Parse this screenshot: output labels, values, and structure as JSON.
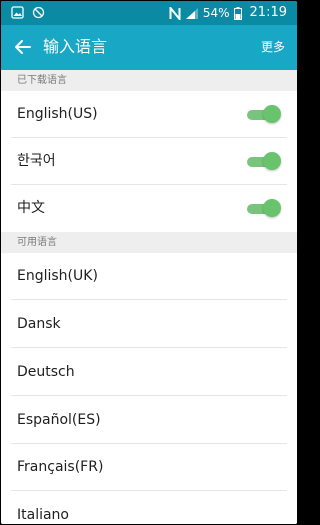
{
  "status_bar": {
    "battery": "54%",
    "time": "21:19"
  },
  "app_bar": {
    "title": "输入语言",
    "more": "更多"
  },
  "downloaded": {
    "header": "已下载语言",
    "items": [
      {
        "label": "English(US)",
        "enabled": true
      },
      {
        "label": "한국어",
        "enabled": true
      },
      {
        "label": "中文",
        "enabled": true
      }
    ]
  },
  "available": {
    "header": "可用语言",
    "items": [
      {
        "label": "English(UK)"
      },
      {
        "label": "Dansk"
      },
      {
        "label": "Deutsch"
      },
      {
        "label": "Español(ES)"
      },
      {
        "label": "Français(FR)"
      },
      {
        "label": "Italiano"
      }
    ]
  },
  "colors": {
    "status_bar": "#0b8aa3",
    "app_bar": "#18a8c5",
    "toggle_on": "#69c36c",
    "section_bg": "#eeeeee"
  }
}
